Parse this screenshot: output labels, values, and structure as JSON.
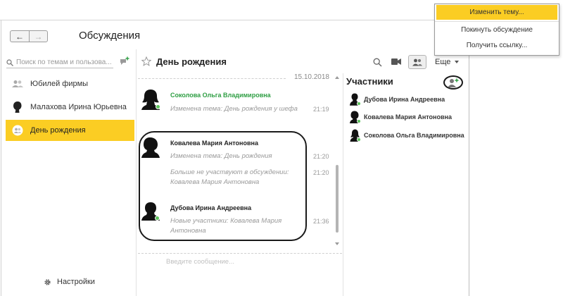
{
  "window": {
    "title": "Обсуждения",
    "back_glyph": "←",
    "forward_glyph": "→"
  },
  "sidebar": {
    "search_placeholder": "Поиск по темам и пользова...",
    "items": [
      {
        "label": "Юбилей фирмы",
        "icon": "group-icon",
        "active": false
      },
      {
        "label": "Малахова Ирина Юрьевна",
        "icon": "person-icon",
        "active": false
      },
      {
        "label": "День рождения",
        "icon": "group-icon",
        "active": true
      }
    ],
    "settings_label": "Настройки"
  },
  "discussion": {
    "title": "День рождения",
    "more_label": "Еще",
    "date": "15.10.2018",
    "messages": [
      {
        "author": "Соколова Ольга Владимировна",
        "text": "Изменена тема: День рождения у шефа",
        "time": "21:19"
      },
      {
        "author": "Ковалева Мария Антоновна",
        "text": "Изменена тема: День рождения",
        "time": "21:20"
      },
      {
        "author": "",
        "text": "Больше не участвуют в обсуждении: Ковалева Мария Антоновна",
        "time": "21:20"
      },
      {
        "author": "Дубова Ирина Андреевна",
        "text": "Новые участники: Ковалева Мария Антоновна",
        "time": "21:36"
      }
    ],
    "input_placeholder": "Введите сообщение..."
  },
  "menu": {
    "items": [
      {
        "label": "Изменить тему...",
        "highlighted": true
      },
      {
        "label": "Покинуть обсуждение",
        "highlighted": false
      },
      {
        "label": "Получить ссылку...",
        "highlighted": false
      }
    ]
  },
  "participants": {
    "title": "Участники",
    "list": [
      {
        "name": "Дубова Ирина Андреевна",
        "online": true
      },
      {
        "name": "Ковалева Мария Антоновна",
        "online": true
      },
      {
        "name": "Соколова Ольга Владимировна",
        "online": true
      }
    ]
  },
  "colors": {
    "accent": "#fbcd23",
    "online": "#5cc35b",
    "author_highlight": "#2e9e43"
  }
}
